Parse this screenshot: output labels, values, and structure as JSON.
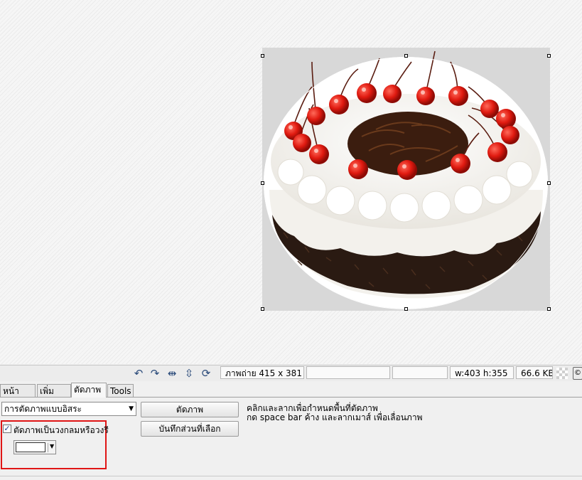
{
  "toolbar": {
    "icons": [
      "undo-icon",
      "redo-icon",
      "fit-width-icon",
      "fit-height-icon",
      "rotate-icon"
    ],
    "status_image": "ภาพถ่าย 415 x 381",
    "status_field2": "",
    "status_field3": "",
    "status_selection": "w:403 h:355",
    "status_size": "66.6 KB"
  },
  "tabs": [
    {
      "label": "หน้าหลัก",
      "active": false
    },
    {
      "label": "เพิ่มวัตถุ",
      "active": false
    },
    {
      "label": "ตัดภาพ",
      "active": true
    },
    {
      "label": "Tools",
      "active": false
    }
  ],
  "crop_panel": {
    "mode_select": "การตัดภาพแบบอิสระ",
    "crop_button": "ตัดภาพ",
    "save_selection_button": "บันทึกส่วนที่เลือก",
    "hint_line1": "คลิกและลากเพื่อกำหนดพื้นที่ตัดภาพ",
    "hint_line2": "กด space bar ค้าง และลากเมาส์ เพื่อเลื่อนภาพ",
    "ellipse_checkbox_label": "ตัดภาพเป็นวงกลมหรือวงรี",
    "ellipse_checked": true,
    "ellipse_check_mark": "✓",
    "fill_color": "#ffffff",
    "highlight_color": "#e01515"
  },
  "image": {
    "subject": "black forest cake with cherries",
    "background": "#d8d8d8"
  }
}
